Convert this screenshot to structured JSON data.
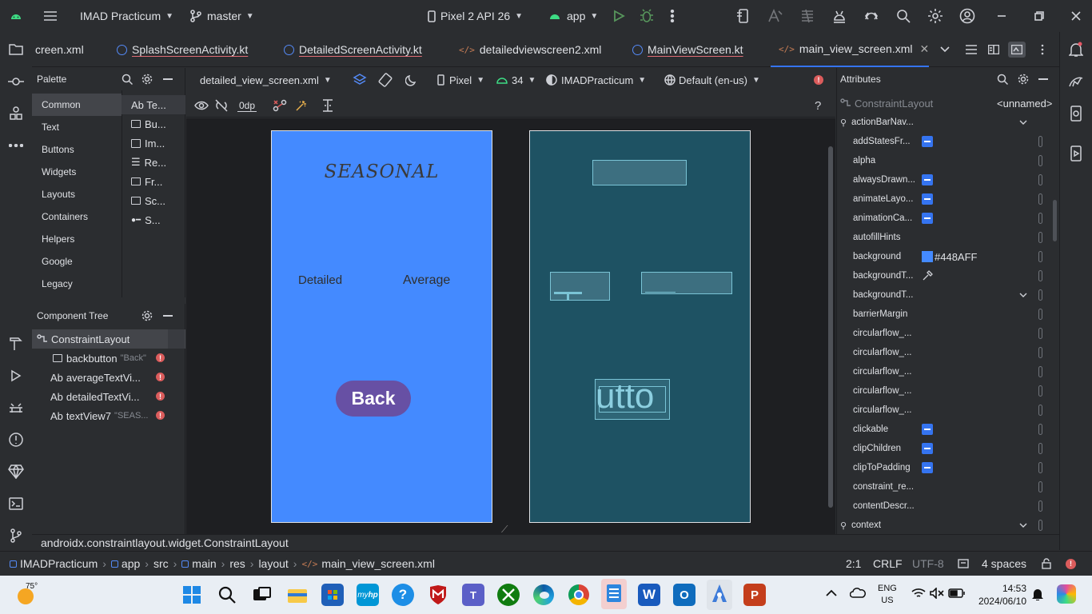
{
  "topbar": {
    "project": "IMAD Practicum",
    "branch": "master",
    "device": "Pixel 2 API 26",
    "run_config": "app"
  },
  "tabs": [
    {
      "label": "creen.xml"
    },
    {
      "label": "SplashScreenActivity.kt"
    },
    {
      "label": "DetailedScreenActivity.kt"
    },
    {
      "label": "detailedviewscreen2.xml"
    },
    {
      "label": "MainViewScreen.kt"
    },
    {
      "label": "main_view_screen.xml",
      "active": true
    }
  ],
  "palette": {
    "title": "Palette",
    "categories": [
      "Common",
      "Text",
      "Buttons",
      "Widgets",
      "Layouts",
      "Containers",
      "Helpers",
      "Google",
      "Legacy"
    ],
    "items": [
      "Ab Te...",
      "Bu...",
      "Im...",
      "Re...",
      "Fr...",
      "Sc...",
      "S..."
    ]
  },
  "component_tree": {
    "title": "Component Tree",
    "root": "ConstraintLayout",
    "nodes": [
      {
        "prefix": "",
        "name": "backbutton",
        "hint": "\"Back\""
      },
      {
        "prefix": "Ab",
        "name": "averageTextVi...",
        "hint": ""
      },
      {
        "prefix": "Ab",
        "name": "detailedTextVi...",
        "hint": ""
      },
      {
        "prefix": "Ab",
        "name": "textView7",
        "hint": "\"SEAS..."
      }
    ]
  },
  "editor": {
    "file": "detailed_view_screen.xml",
    "device": "Pixel",
    "api": "34",
    "theme": "IMADPracticum",
    "locale": "Default (en-us)",
    "margin": "0dp",
    "help": "?"
  },
  "design": {
    "title": "SEASONAL",
    "detailed": "Detailed",
    "average": "Average",
    "back": "Back",
    "bg_color": "#448AFF",
    "button_color": "#6750A4"
  },
  "blueprint": {
    "button_text": "utto"
  },
  "attributes": {
    "title": "Attributes",
    "class": "ConstraintLayout",
    "id": "<unnamed>",
    "rows": [
      {
        "name": "actionBarNav...",
        "type": "group"
      },
      {
        "name": "addStatesFr...",
        "type": "check"
      },
      {
        "name": "alpha",
        "type": "empty"
      },
      {
        "name": "alwaysDrawn...",
        "type": "check"
      },
      {
        "name": "animateLayo...",
        "type": "check"
      },
      {
        "name": "animationCa...",
        "type": "check"
      },
      {
        "name": "autofillHints",
        "type": "empty"
      },
      {
        "name": "background",
        "type": "color",
        "value": "#448AFF"
      },
      {
        "name": "backgroundT...",
        "type": "picker"
      },
      {
        "name": "backgroundT...",
        "type": "dropdown"
      },
      {
        "name": "barrierMargin",
        "type": "empty"
      },
      {
        "name": "circularflow_...",
        "type": "empty"
      },
      {
        "name": "circularflow_...",
        "type": "empty"
      },
      {
        "name": "circularflow_...",
        "type": "empty"
      },
      {
        "name": "circularflow_...",
        "type": "empty"
      },
      {
        "name": "circularflow_...",
        "type": "empty"
      },
      {
        "name": "clickable",
        "type": "check"
      },
      {
        "name": "clipChildren",
        "type": "check"
      },
      {
        "name": "clipToPadding",
        "type": "check"
      },
      {
        "name": "constraint_re...",
        "type": "empty"
      },
      {
        "name": "contentDescr...",
        "type": "empty"
      },
      {
        "name": "context",
        "type": "group"
      }
    ]
  },
  "status": {
    "class_path": "androidx.constraintlayout.widget.ConstraintLayout",
    "breadcrumb": [
      "IMADPracticum",
      "app",
      "src",
      "main",
      "res",
      "layout",
      "main_view_screen.xml"
    ],
    "position": "2:1",
    "line_sep": "CRLF",
    "encoding": "UTF-8",
    "indent": "4 spaces"
  },
  "taskbar": {
    "weather": "75°",
    "lang1": "ENG",
    "lang2": "US",
    "time": "14:53",
    "date": "2024/06/10"
  }
}
